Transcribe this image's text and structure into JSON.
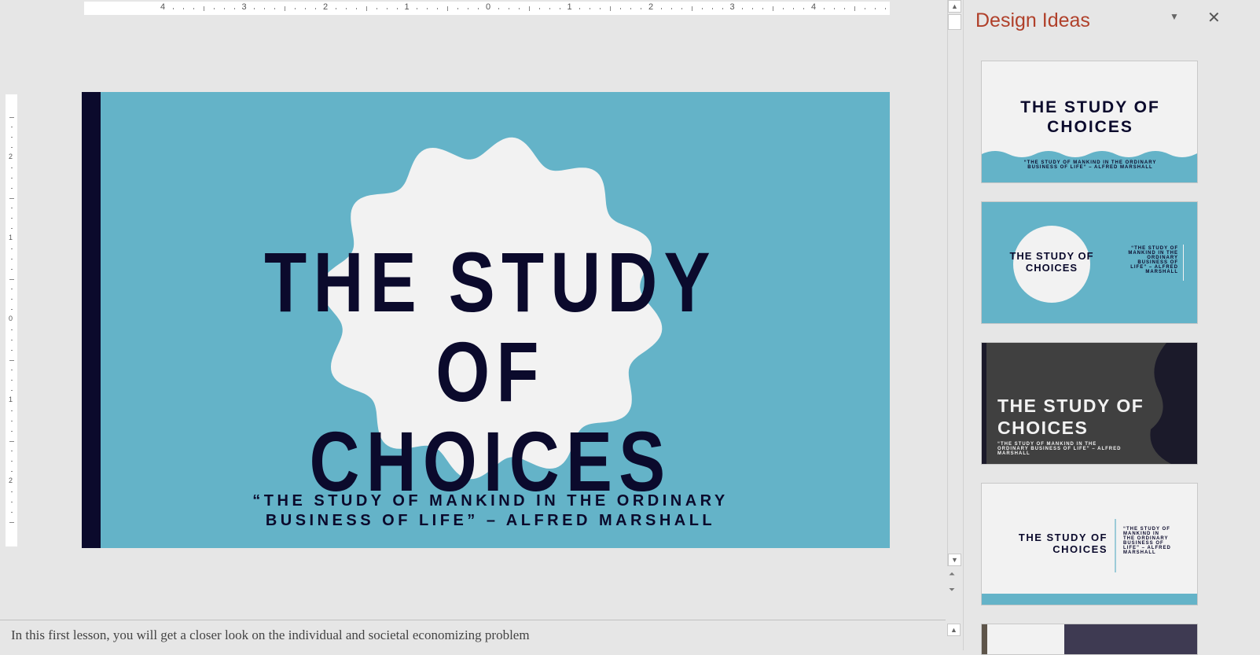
{
  "ruler": {
    "h_labels": [
      "4",
      "3",
      "2",
      "1",
      "0",
      "1",
      "2",
      "3",
      "4"
    ],
    "v_labels": [
      "2",
      "1",
      "0",
      "1",
      "2"
    ]
  },
  "slide": {
    "title_line1": "THE STUDY OF",
    "title_line2": "CHOICES",
    "subtitle_line1": "“THE STUDY OF MANKIND IN THE ORDINARY",
    "subtitle_line2": "BUSINESS OF LIFE” – ALFRED MARSHALL",
    "colors": {
      "background": "#64b3c8",
      "accent": "#0b0a2c",
      "shape": "#f2f2f2"
    }
  },
  "design_ideas": {
    "title": "Design Ideas",
    "dropdown_icon": "chevron-down-icon",
    "close_icon": "close-icon",
    "thumbs": [
      {
        "title1": "THE STUDY OF",
        "title2": "CHOICES",
        "sub": "“THE STUDY OF MANKIND IN THE ORDINARY BUSINESS OF LIFE” – ALFRED MARSHALL"
      },
      {
        "title1": "THE STUDY OF",
        "title2": "CHOICES",
        "sub": "“THE STUDY OF MANKIND IN THE ORDINARY BUSINESS OF LIFE” – ALFRED MARSHALL"
      },
      {
        "title1": "THE STUDY OF",
        "title2": "CHOICES",
        "sub": "“THE STUDY OF MANKIND IN THE ORDINARY BUSINESS OF LIFE” – ALFRED MARSHALL"
      },
      {
        "title1": "THE STUDY OF",
        "title2": "CHOICES",
        "sub": "“THE STUDY OF MANKIND IN THE ORDINARY BUSINESS OF LIFE” – ALFRED MARSHALL"
      }
    ]
  },
  "notes": {
    "text": "In this first lesson, you will get a closer look on the individual and societal economizing problem"
  }
}
